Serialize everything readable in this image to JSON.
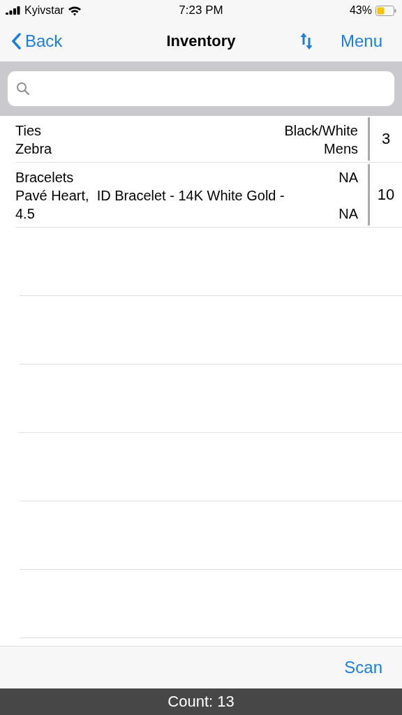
{
  "status_bar": {
    "carrier": "Kyivstar",
    "time": "7:23 PM",
    "battery": "43%"
  },
  "nav_bar": {
    "back": "Back",
    "title": "Inventory",
    "menu": "Menu"
  },
  "rows": [
    {
      "name": "Ties",
      "description": "Zebra",
      "attr_1": "Black/White",
      "attr_2": "Mens",
      "quantity": "3"
    },
    {
      "name": "Bracelets",
      "description": "Pavé Heart,  ID Bracelet - 14K White Gold - 4.5",
      "attr_1": "NA",
      "attr_2": "NA",
      "quantity": "10"
    }
  ],
  "toolbar": {
    "scan": "Scan"
  },
  "footer": {
    "count": "Count: 13"
  }
}
